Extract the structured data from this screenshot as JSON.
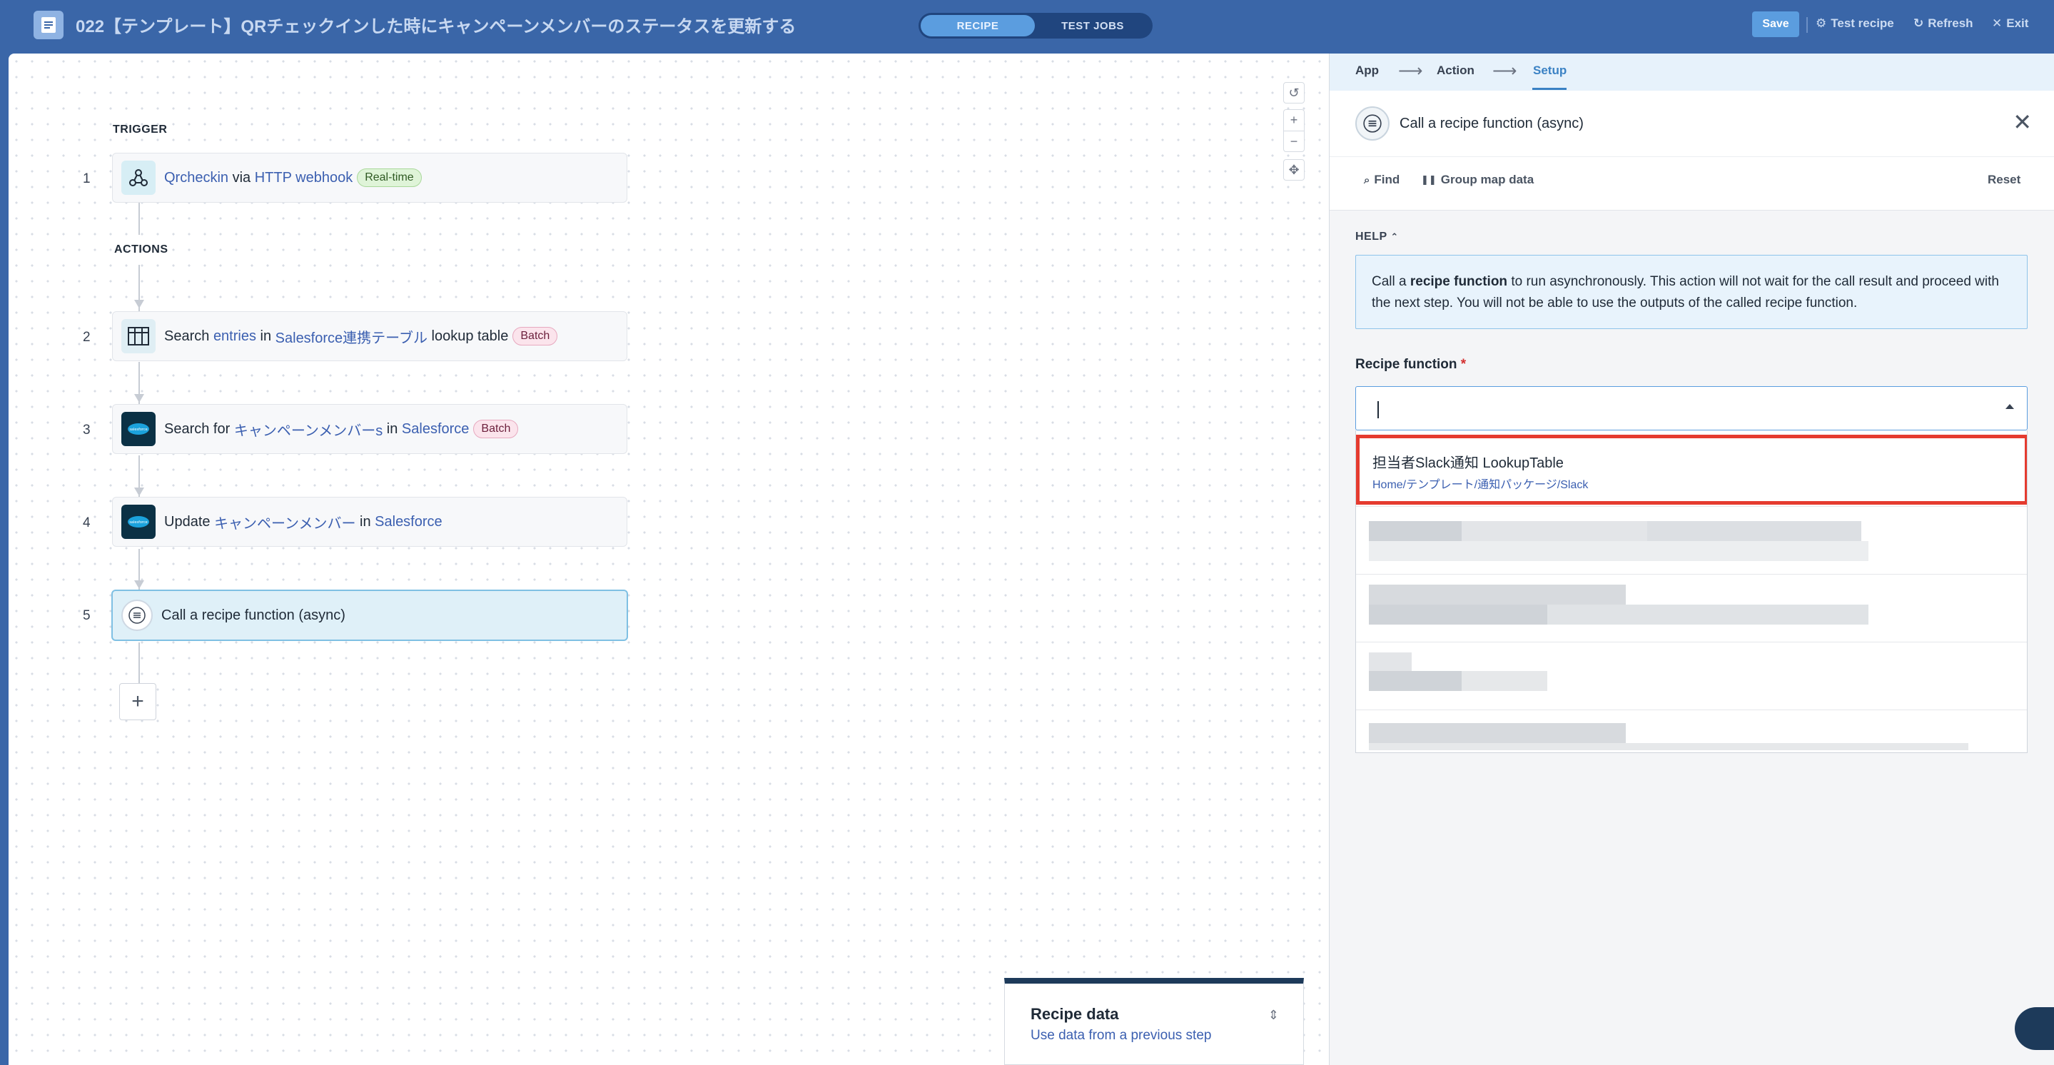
{
  "header": {
    "title": "022【テンプレート】QRチェックインした時にキャンペーンメンバーのステータスを更新する",
    "tabs": [
      "RECIPE",
      "TEST JOBS"
    ],
    "save": "Save",
    "test_recipe": "Test recipe",
    "refresh": "Refresh",
    "exit": "Exit"
  },
  "canvas": {
    "trigger_label": "TRIGGER",
    "actions_label": "ACTIONS",
    "steps": [
      {
        "num": "1",
        "parts": [
          "Qrcheckin",
          " via ",
          "HTTP webhook"
        ],
        "badge": "Real-time"
      },
      {
        "num": "2",
        "parts": [
          "Search ",
          "entries",
          " in ",
          "Salesforce連携テーブル",
          " lookup table"
        ],
        "badge": "Batch"
      },
      {
        "num": "3",
        "parts": [
          "Search for ",
          "キャンペーンメンバーs",
          " in ",
          "Salesforce"
        ],
        "badge": "Batch"
      },
      {
        "num": "4",
        "parts": [
          "Update ",
          "キャンペーンメンバー",
          " in ",
          "Salesforce"
        ]
      },
      {
        "num": "5",
        "parts": [
          "Call a recipe function (async)"
        ]
      }
    ],
    "add_label": "+",
    "recipe_data": {
      "title": "Recipe data",
      "subtitle": "Use data from a previous step"
    }
  },
  "panel": {
    "breadcrumb": [
      "App",
      "Action",
      "Setup"
    ],
    "title": "Call a recipe function (async)",
    "find": "Find",
    "group_map": "Group map data",
    "reset": "Reset",
    "help_label": "HELP",
    "help_text_1": "Call a ",
    "help_text_bold": "recipe function",
    "help_text_2": " to run asynchronously. This action will not wait for the call result and proceed with the next step. You will not be able to use the outputs of the called recipe function.",
    "field_label": "Recipe function",
    "required_mark": "*",
    "options": [
      {
        "name": "担当者Slack通知 LookupTable",
        "path": "Home/テンプレート/通知パッケージ/Slack"
      }
    ]
  },
  "colors": {
    "accent": "#3a66a8",
    "highlight": "#e53b2f",
    "link": "#3b5fb0"
  }
}
